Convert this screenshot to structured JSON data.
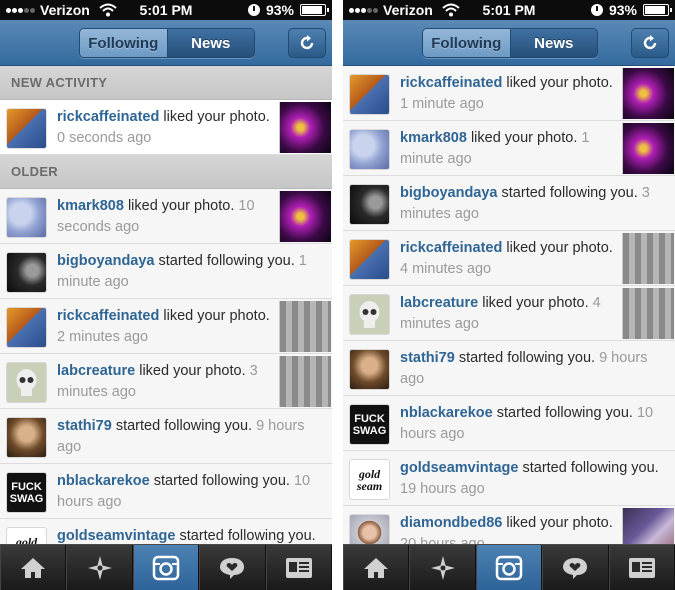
{
  "status": {
    "carrier": "Verizon",
    "time": "5:01 PM",
    "battery": "93%",
    "battery_level": 0.93
  },
  "header": {
    "following": "Following",
    "news": "News"
  },
  "left": {
    "section_new": "NEW ACTIVITY",
    "section_older": "OLDER",
    "new_items": [
      {
        "user": "rickcaffeinated",
        "action": " liked your photo.",
        "time": "0 seconds ago"
      }
    ],
    "items": [
      {
        "user": "kmark808",
        "action": " liked your photo.",
        "time": "10 seconds ago"
      },
      {
        "user": "bigboyandaya",
        "action": " started following you.",
        "time": "1 minute ago"
      },
      {
        "user": "rickcaffeinated",
        "action": " liked your photo.",
        "time": "2 minutes ago"
      },
      {
        "user": "labcreature",
        "action": " liked your photo.",
        "time": "3 minutes ago"
      },
      {
        "user": "stathi79",
        "action": " started following you.",
        "time": "9 hours ago"
      },
      {
        "user": "nblackarekoe",
        "action": " started following you.",
        "time": "10 hours ago"
      },
      {
        "user": "goldseamvintage",
        "action": " started following you.",
        "time": ""
      }
    ]
  },
  "right": {
    "items": [
      {
        "user": "rickcaffeinated",
        "action": " liked your photo.",
        "time": "1 minute ago"
      },
      {
        "user": "kmark808",
        "action": " liked your photo.",
        "time": "1 minute ago"
      },
      {
        "user": "bigboyandaya",
        "action": " started following you.",
        "time": "3 minutes ago"
      },
      {
        "user": "rickcaffeinated",
        "action": " liked your photo.",
        "time": "4 minutes ago"
      },
      {
        "user": "labcreature",
        "action": " liked your photo.",
        "time": "4 minutes ago"
      },
      {
        "user": "stathi79",
        "action": " started following you.",
        "time": "9 hours ago"
      },
      {
        "user": "nblackarekoe",
        "action": " started following you.",
        "time": "10 hours ago"
      },
      {
        "user": "goldseamvintage",
        "action": " started following you.",
        "time": "19 hours ago"
      },
      {
        "user": "diamondbed86",
        "action": " liked your photo.",
        "time": "20 hours ago"
      }
    ]
  },
  "avatar_text": {
    "fuck_swag": "FUCK SWAG",
    "gold_seam": "gold seam"
  },
  "tabs": [
    "home-icon",
    "explore-icon",
    "camera-icon",
    "news-icon",
    "profile-icon"
  ],
  "colors": {
    "username": "#2f6594",
    "nav": "#336a9e",
    "active_tab": "#2e6399"
  }
}
